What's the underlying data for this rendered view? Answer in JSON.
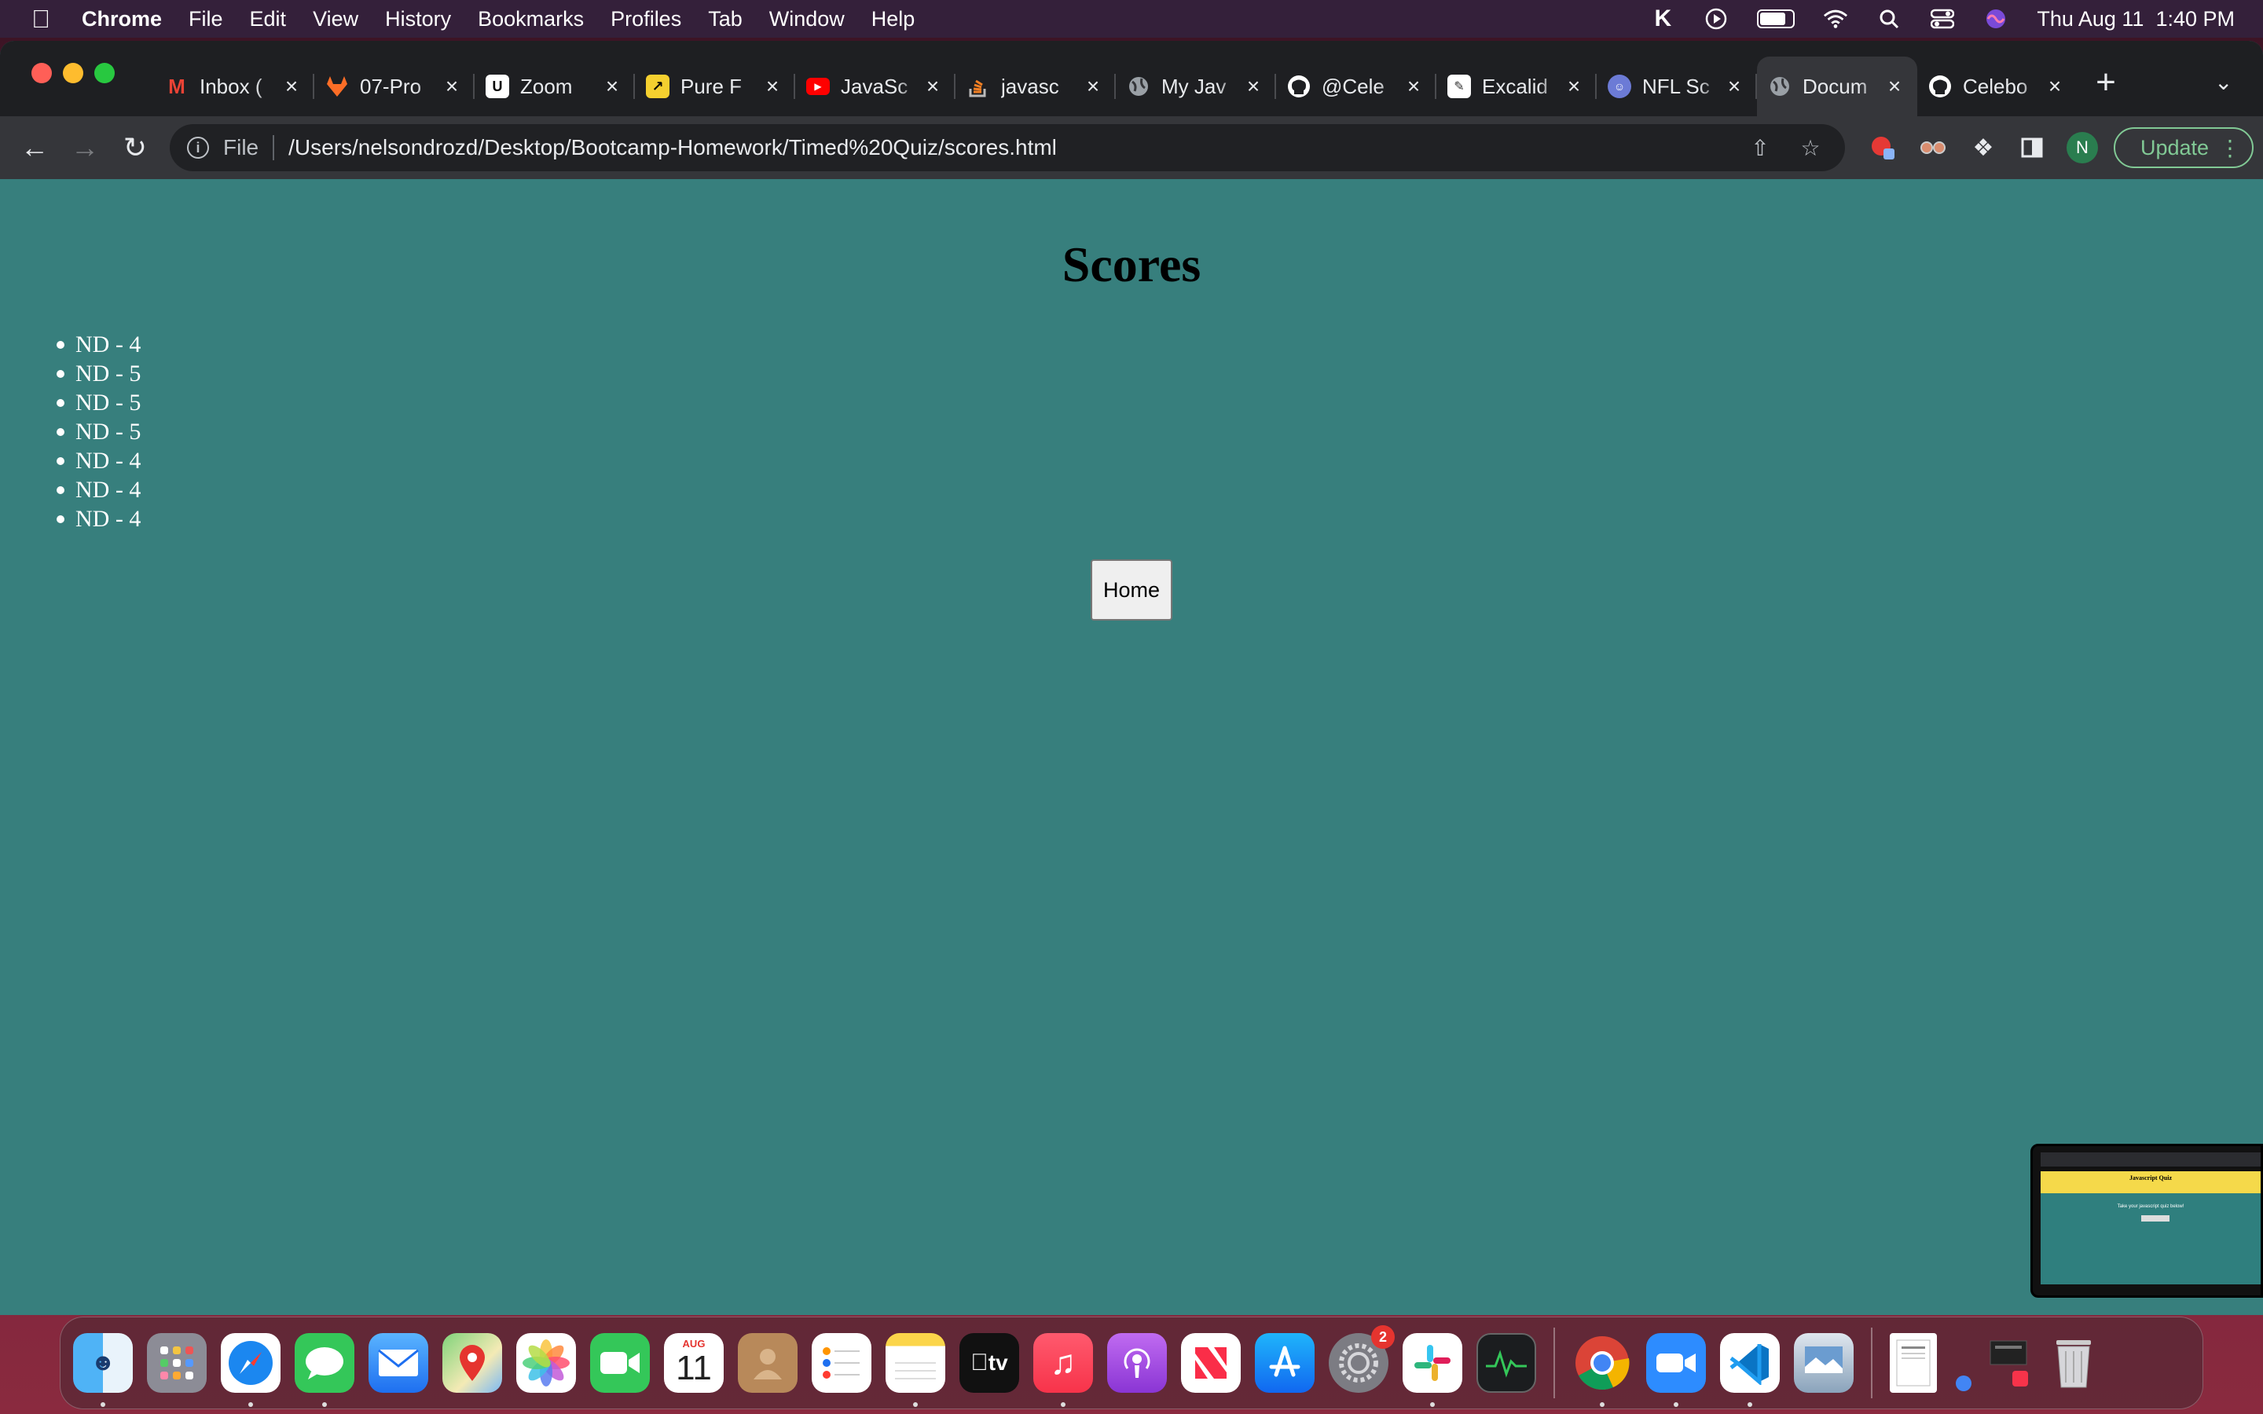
{
  "menubar": {
    "app_name": "Chrome",
    "menus": [
      "File",
      "Edit",
      "View",
      "History",
      "Bookmarks",
      "Profiles",
      "Tab",
      "Window",
      "Help"
    ],
    "clock": "Thu Aug 11  1:40 PM"
  },
  "tabs": [
    {
      "title": "Inbox (",
      "icon": "gmail-icon",
      "color": "#ea4335"
    },
    {
      "title": "07-Pro",
      "icon": "gitlab-icon",
      "color": "#fc6d26"
    },
    {
      "title": "Zoom",
      "icon": "zoom-doc-icon",
      "color": "#ffffff"
    },
    {
      "title": "Pure F",
      "icon": "pure-icon",
      "color": "#f5d02f"
    },
    {
      "title": "JavaSc",
      "icon": "youtube-icon",
      "color": "#ff0000"
    },
    {
      "title": "javasc",
      "icon": "stackoverflow-icon",
      "color": "#f48024"
    },
    {
      "title": "My Jav",
      "icon": "globe-icon",
      "color": "#9aa0a6"
    },
    {
      "title": "@Cele",
      "icon": "github-icon",
      "color": "#ffffff"
    },
    {
      "title": "Excalid",
      "icon": "excalidraw-icon",
      "color": "#ffffff"
    },
    {
      "title": "NFL Sc",
      "icon": "nfl-icon",
      "color": "#6c7bd6"
    },
    {
      "title": "Docum",
      "icon": "globe-icon",
      "color": "#9aa0a6",
      "active": true
    },
    {
      "title": "Celebo",
      "icon": "github-icon",
      "color": "#ffffff"
    }
  ],
  "omnibox": {
    "scheme": "File",
    "url": "/Users/nelsondrozd/Desktop/Bootcamp-Homework/Timed%20Quiz/scores.html"
  },
  "profile_initial": "N",
  "update_label": "Update",
  "page": {
    "title": "Scores",
    "scores": [
      "ND - 4",
      "ND - 5",
      "ND - 5",
      "ND - 5",
      "ND - 4",
      "ND - 4",
      "ND - 4"
    ],
    "home_button": "Home",
    "background": "#377f7d"
  },
  "thumbnail": {
    "title": "Javascript Quiz",
    "text": "Take your javascript quiz below!"
  },
  "dock": {
    "calendar_month": "AUG",
    "calendar_day": "11",
    "tv_label": "tv",
    "settings_badge": "2"
  }
}
